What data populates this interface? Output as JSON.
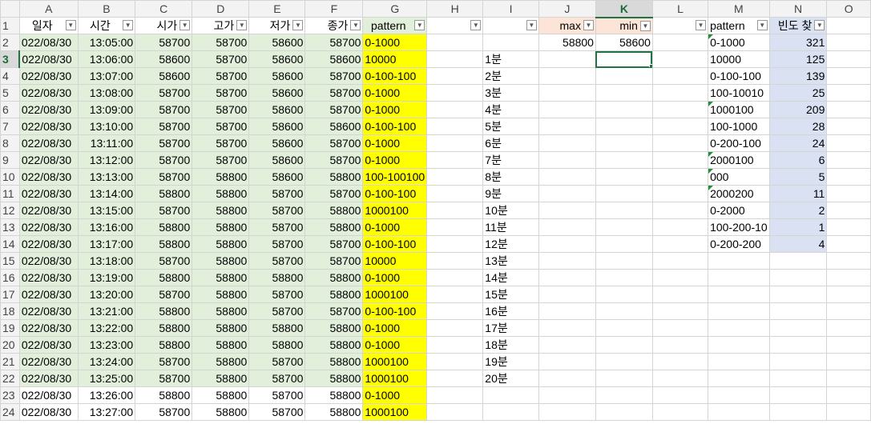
{
  "columns": [
    "A",
    "B",
    "C",
    "D",
    "E",
    "F",
    "G",
    "H",
    "I",
    "J",
    "K",
    "L",
    "M",
    "N",
    "O"
  ],
  "selected_column": "K",
  "selected_row": 3,
  "header_row": {
    "A": "일자",
    "B": "시간",
    "C": "시가",
    "D": "고가",
    "E": "저가",
    "F": "종가",
    "G": "pattern",
    "H": "",
    "I": "",
    "J": "max",
    "K": "min",
    "L": "",
    "M": "pattern",
    "N": "빈도 찾"
  },
  "filter_icon": "chevron-down-icon",
  "data_rows": [
    {
      "row": 2,
      "date": "022/08/30",
      "time": "13:05:00",
      "open": "58700",
      "high": "58700",
      "low": "58600",
      "close": "58700",
      "pattern": "0-1000",
      "i": "",
      "j": "58800",
      "k": "58600",
      "m": "0-1000",
      "n": "321"
    },
    {
      "row": 3,
      "date": "022/08/30",
      "time": "13:06:00",
      "open": "58600",
      "high": "58700",
      "low": "58600",
      "close": "58600",
      "pattern": "10000",
      "i": "1분",
      "j": "",
      "k": "",
      "m": "10000",
      "n": "125"
    },
    {
      "row": 4,
      "date": "022/08/30",
      "time": "13:07:00",
      "open": "58600",
      "high": "58700",
      "low": "58600",
      "close": "58700",
      "pattern": "0-100-100",
      "i": "2분",
      "j": "",
      "k": "",
      "m": "0-100-100",
      "n": "139"
    },
    {
      "row": 5,
      "date": "022/08/30",
      "time": "13:08:00",
      "open": "58700",
      "high": "58700",
      "low": "58600",
      "close": "58700",
      "pattern": "0-1000",
      "i": "3분",
      "j": "",
      "k": "",
      "m": "100-10010",
      "n": "25"
    },
    {
      "row": 6,
      "date": "022/08/30",
      "time": "13:09:00",
      "open": "58700",
      "high": "58700",
      "low": "58600",
      "close": "58700",
      "pattern": "0-1000",
      "i": "4분",
      "j": "",
      "k": "",
      "m": "1000100",
      "n": "209"
    },
    {
      "row": 7,
      "date": "022/08/30",
      "time": "13:10:00",
      "open": "58700",
      "high": "58700",
      "low": "58600",
      "close": "58600",
      "pattern": "0-100-100",
      "i": "5분",
      "j": "",
      "k": "",
      "m": "100-1000",
      "n": "28"
    },
    {
      "row": 8,
      "date": "022/08/30",
      "time": "13:11:00",
      "open": "58700",
      "high": "58700",
      "low": "58600",
      "close": "58700",
      "pattern": "0-1000",
      "i": "6분",
      "j": "",
      "k": "",
      "m": "0-200-100",
      "n": "24"
    },
    {
      "row": 9,
      "date": "022/08/30",
      "time": "13:12:00",
      "open": "58700",
      "high": "58700",
      "low": "58600",
      "close": "58700",
      "pattern": "0-1000",
      "i": "7분",
      "j": "",
      "k": "",
      "m": "2000100",
      "n": "6"
    },
    {
      "row": 10,
      "date": "022/08/30",
      "time": "13:13:00",
      "open": "58700",
      "high": "58800",
      "low": "58600",
      "close": "58800",
      "pattern": "100-100100",
      "i": "8분",
      "j": "",
      "k": "",
      "m": "000",
      "n": "5"
    },
    {
      "row": 11,
      "date": "022/08/30",
      "time": "13:14:00",
      "open": "58800",
      "high": "58800",
      "low": "58700",
      "close": "58700",
      "pattern": "0-100-100",
      "i": "9분",
      "j": "",
      "k": "",
      "m": "2000200",
      "n": "11"
    },
    {
      "row": 12,
      "date": "022/08/30",
      "time": "13:15:00",
      "open": "58700",
      "high": "58800",
      "low": "58700",
      "close": "58800",
      "pattern": "1000100",
      "i": "10분",
      "j": "",
      "k": "",
      "m": "0-2000",
      "n": "2"
    },
    {
      "row": 13,
      "date": "022/08/30",
      "time": "13:16:00",
      "open": "58800",
      "high": "58800",
      "low": "58700",
      "close": "58800",
      "pattern": "0-1000",
      "i": "11분",
      "j": "",
      "k": "",
      "m": "100-200-10",
      "n": "1"
    },
    {
      "row": 14,
      "date": "022/08/30",
      "time": "13:17:00",
      "open": "58800",
      "high": "58800",
      "low": "58700",
      "close": "58700",
      "pattern": "0-100-100",
      "i": "12분",
      "j": "",
      "k": "",
      "m": "0-200-200",
      "n": "4"
    },
    {
      "row": 15,
      "date": "022/08/30",
      "time": "13:18:00",
      "open": "58700",
      "high": "58800",
      "low": "58700",
      "close": "58700",
      "pattern": "10000",
      "i": "13분",
      "j": "",
      "k": "",
      "m": "",
      "n": ""
    },
    {
      "row": 16,
      "date": "022/08/30",
      "time": "13:19:00",
      "open": "58800",
      "high": "58800",
      "low": "58800",
      "close": "58800",
      "pattern": "0-1000",
      "i": "14분",
      "j": "",
      "k": "",
      "m": "",
      "n": ""
    },
    {
      "row": 17,
      "date": "022/08/30",
      "time": "13:20:00",
      "open": "58700",
      "high": "58800",
      "low": "58700",
      "close": "58800",
      "pattern": "1000100",
      "i": "15분",
      "j": "",
      "k": "",
      "m": "",
      "n": ""
    },
    {
      "row": 18,
      "date": "022/08/30",
      "time": "13:21:00",
      "open": "58800",
      "high": "58800",
      "low": "58700",
      "close": "58700",
      "pattern": "0-100-100",
      "i": "16분",
      "j": "",
      "k": "",
      "m": "",
      "n": ""
    },
    {
      "row": 19,
      "date": "022/08/30",
      "time": "13:22:00",
      "open": "58800",
      "high": "58800",
      "low": "58800",
      "close": "58800",
      "pattern": "0-1000",
      "i": "17분",
      "j": "",
      "k": "",
      "m": "",
      "n": ""
    },
    {
      "row": 20,
      "date": "022/08/30",
      "time": "13:23:00",
      "open": "58800",
      "high": "58800",
      "low": "58800",
      "close": "58800",
      "pattern": "0-1000",
      "i": "18분",
      "j": "",
      "k": "",
      "m": "",
      "n": ""
    },
    {
      "row": 21,
      "date": "022/08/30",
      "time": "13:24:00",
      "open": "58700",
      "high": "58800",
      "low": "58700",
      "close": "58800",
      "pattern": "1000100",
      "i": "19분",
      "j": "",
      "k": "",
      "m": "",
      "n": ""
    },
    {
      "row": 22,
      "date": "022/08/30",
      "time": "13:25:00",
      "open": "58700",
      "high": "58800",
      "low": "58700",
      "close": "58800",
      "pattern": "1000100",
      "i": "20분",
      "j": "",
      "k": "",
      "m": "",
      "n": ""
    },
    {
      "row": 23,
      "date": "022/08/30",
      "time": "13:26:00",
      "open": "58800",
      "high": "58800",
      "low": "58700",
      "close": "58800",
      "pattern": "0-1000",
      "i": "",
      "j": "",
      "k": "",
      "m": "",
      "n": ""
    },
    {
      "row": 24,
      "date": "022/08/30",
      "time": "13:27:00",
      "open": "58700",
      "high": "58800",
      "low": "58700",
      "close": "58800",
      "pattern": "1000100",
      "i": "",
      "j": "",
      "k": "",
      "m": "",
      "n": ""
    }
  ],
  "m_text_marker_rows": [
    2,
    6,
    9,
    10,
    11
  ],
  "colors": {
    "green_fill": "#e2efda",
    "yellow_fill": "#ffff00",
    "salmon_fill": "#fce4d6",
    "lavender_fill": "#d9e1f2",
    "selection": "#217346"
  }
}
